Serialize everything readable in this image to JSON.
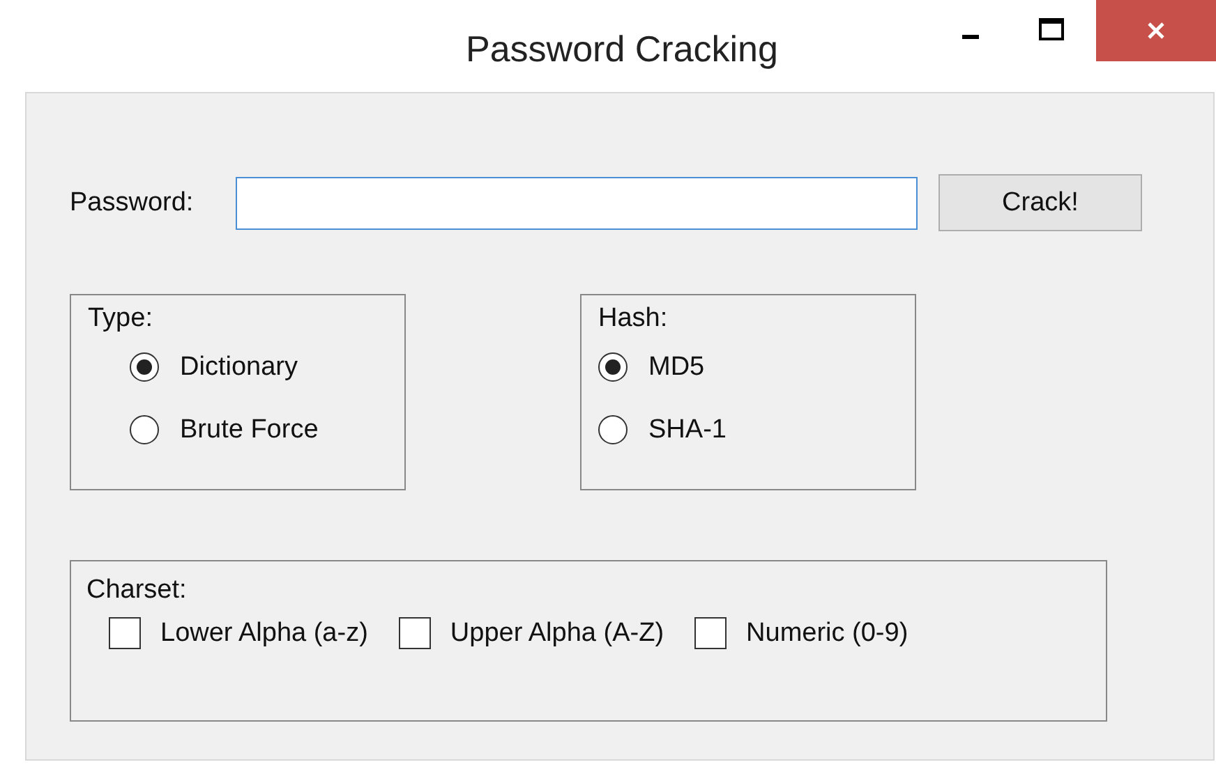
{
  "window": {
    "title": "Password Cracking"
  },
  "password": {
    "label": "Password:"
  },
  "crack_button": "Crack!",
  "groups": [
    {
      "title": "Type:",
      "options": [
        {
          "label": "Dictionary",
          "selected": true
        },
        {
          "label": "Brute Force",
          "selected": false
        }
      ]
    },
    {
      "title": "Hash:",
      "options": [
        {
          "label": "MD5",
          "selected": true
        },
        {
          "label": "SHA-1",
          "selected": false
        }
      ]
    }
  ],
  "charset": {
    "title": "Charset:",
    "options": [
      {
        "label": "Lower Alpha (a-z)",
        "checked": false
      },
      {
        "label": "Upper Alpha (A-Z)",
        "checked": false
      },
      {
        "label": "Numeric (0-9)",
        "checked": false
      }
    ]
  }
}
